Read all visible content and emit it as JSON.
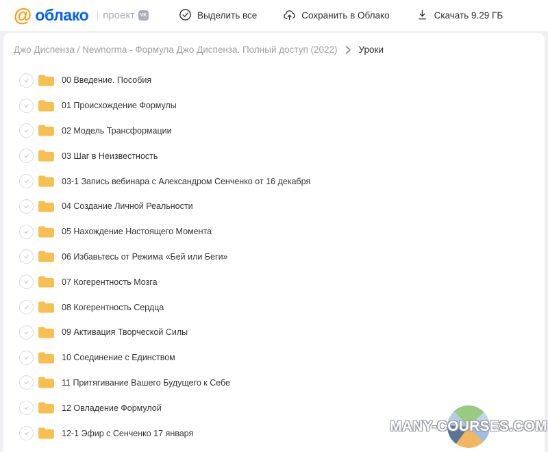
{
  "header": {
    "logo": {
      "at": "@",
      "brand": "облако",
      "divider": "|",
      "project": "проект",
      "vk": "VK"
    },
    "toolbar": [
      {
        "icon": "check-circle-icon",
        "label": "Выделить все"
      },
      {
        "icon": "cloud-upload-icon",
        "label": "Сохранить в Облако"
      },
      {
        "icon": "download-icon",
        "label": "Скачать 9.29 ГБ"
      }
    ]
  },
  "breadcrumb": {
    "path": "Джо Диспенза / Newnorma - Формула Джо Диспенза. Полный доступ (2022)",
    "current": "Уроки"
  },
  "files": [
    {
      "name": "00 Введение. Пособия",
      "type": "folder"
    },
    {
      "name": "01 Происхождение Формулы",
      "type": "folder"
    },
    {
      "name": "02 Модель Трансформации",
      "type": "folder"
    },
    {
      "name": "03 Шаг в Неизвестность",
      "type": "folder"
    },
    {
      "name": "03-1 Запись вебинара с Александром Сенченко от 16 декабря",
      "type": "folder"
    },
    {
      "name": "04 Создание Личной Реальности",
      "type": "folder"
    },
    {
      "name": "05 Нахождение Настоящего Момента",
      "type": "folder"
    },
    {
      "name": "06 Избавьтесь от Режима «Бей или Беги»",
      "type": "folder"
    },
    {
      "name": "07 Когерентность Мозга",
      "type": "folder"
    },
    {
      "name": "08 Когерентность Сердца",
      "type": "folder"
    },
    {
      "name": "09 Активация Творческой Силы",
      "type": "folder"
    },
    {
      "name": "10 Соединение с Единством",
      "type": "folder"
    },
    {
      "name": "11 Притягивание Вашего Будущего к Себе",
      "type": "folder"
    },
    {
      "name": "12 Овладение Формулой",
      "type": "folder"
    },
    {
      "name": "12-1 Эфир с Сенченко 17 января",
      "type": "folder"
    }
  ],
  "watermark": {
    "text": "MANY-COURSES.COM"
  },
  "colors": {
    "brand_blue": "#005ff9",
    "brand_orange": "#ff9800",
    "folder_yellow": "#f7bf4f",
    "text_primary": "#2c2d2e",
    "text_secondary": "#9b9ea3"
  }
}
